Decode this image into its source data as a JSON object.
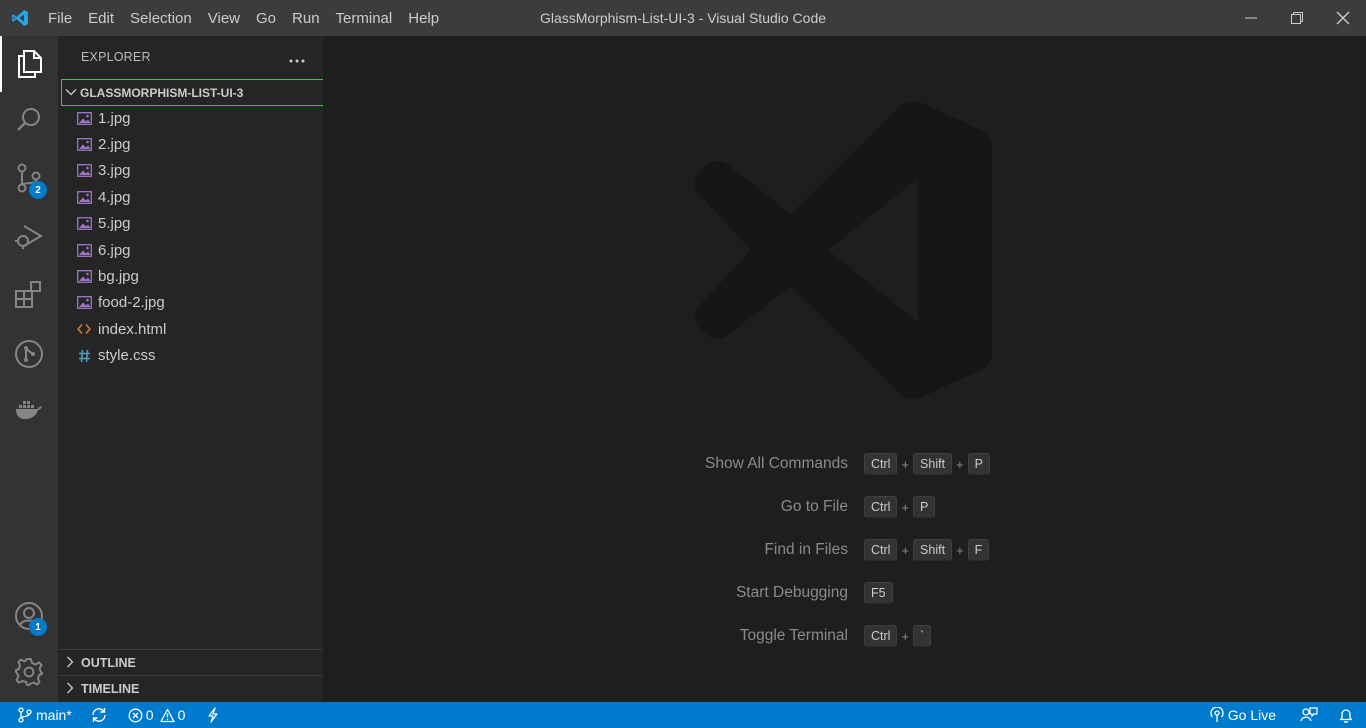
{
  "titlebar": {
    "menu": [
      "File",
      "Edit",
      "Selection",
      "View",
      "Go",
      "Run",
      "Terminal",
      "Help"
    ],
    "title": "GlassMorphism-List-UI-3 - Visual Studio Code"
  },
  "activitybar": {
    "items": [
      {
        "name": "explorer-icon"
      },
      {
        "name": "search-icon"
      },
      {
        "name": "source-control-icon",
        "badge": "2"
      },
      {
        "name": "run-debug-icon"
      },
      {
        "name": "extensions-icon"
      },
      {
        "name": "git-graph-icon"
      },
      {
        "name": "docker-icon"
      }
    ],
    "accounts_badge": "1"
  },
  "sidebar": {
    "title": "EXPLORER",
    "folder": "GLASSMORPHISM-LIST-UI-3",
    "files": [
      {
        "name": "1.jpg",
        "type": "image"
      },
      {
        "name": "2.jpg",
        "type": "image"
      },
      {
        "name": "3.jpg",
        "type": "image"
      },
      {
        "name": "4.jpg",
        "type": "image"
      },
      {
        "name": "5.jpg",
        "type": "image"
      },
      {
        "name": "6.jpg",
        "type": "image"
      },
      {
        "name": "bg.jpg",
        "type": "image"
      },
      {
        "name": "food-2.jpg",
        "type": "image"
      },
      {
        "name": "index.html",
        "type": "html"
      },
      {
        "name": "style.css",
        "type": "css"
      }
    ],
    "outline": "OUTLINE",
    "timeline": "TIMELINE"
  },
  "editor": {
    "shortcuts": [
      {
        "label": "Show All Commands",
        "keys": [
          "Ctrl",
          "Shift",
          "P"
        ]
      },
      {
        "label": "Go to File",
        "keys": [
          "Ctrl",
          "P"
        ]
      },
      {
        "label": "Find in Files",
        "keys": [
          "Ctrl",
          "Shift",
          "F"
        ]
      },
      {
        "label": "Start Debugging",
        "keys": [
          "F5"
        ]
      },
      {
        "label": "Toggle Terminal",
        "keys": [
          "Ctrl",
          "`"
        ]
      }
    ]
  },
  "statusbar": {
    "branch": "main*",
    "errors": "0",
    "warnings": "0",
    "go_live": "Go Live"
  },
  "colors": {
    "accent": "#007acc",
    "folder_focus": "#3ec93e",
    "image_icon": "#a074c4",
    "html_icon": "#e37933",
    "css_icon": "#519aba"
  }
}
